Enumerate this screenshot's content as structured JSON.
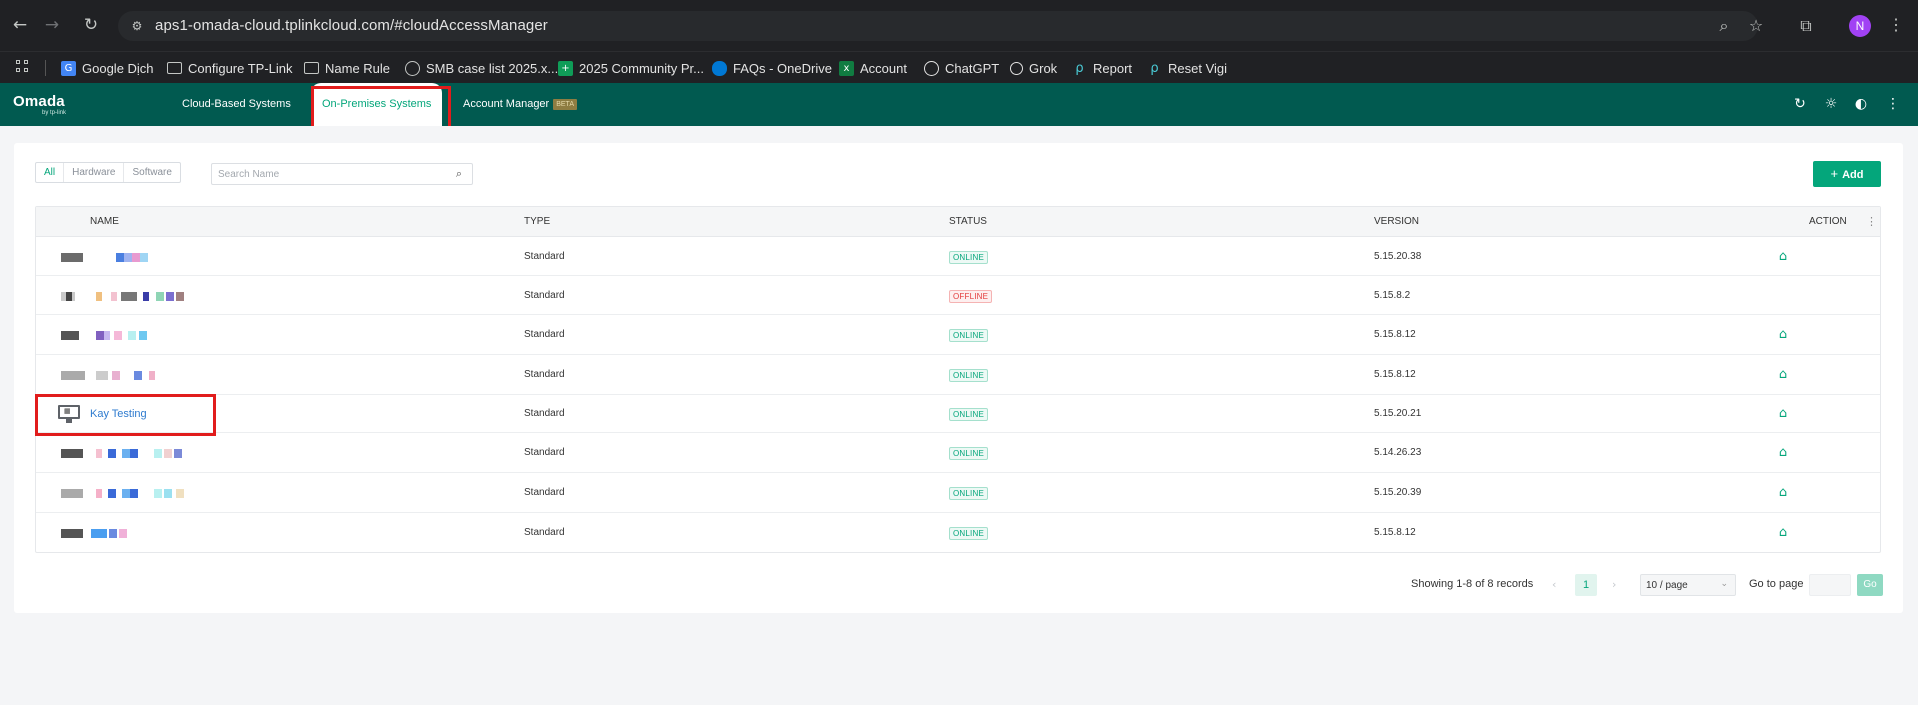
{
  "browser": {
    "url": "aps1-omada-cloud.tplinkcloud.com/#cloudAccessManager",
    "profile_initial": "N",
    "bookmarks": [
      {
        "label": "Google Dịch",
        "icon": "google-translate-icon"
      },
      {
        "label": "Configure TP-Link",
        "icon": "folder-icon"
      },
      {
        "label": "Name Rule",
        "icon": "folder-icon"
      },
      {
        "label": "SMB case list 2025.x...",
        "icon": "globe-icon"
      },
      {
        "label": "2025 Community Pr...",
        "icon": "sheets-icon"
      },
      {
        "label": "FAQs - OneDrive",
        "icon": "onedrive-icon"
      },
      {
        "label": "Account",
        "icon": "excel-icon"
      },
      {
        "label": "ChatGPT",
        "icon": "chatgpt-icon"
      },
      {
        "label": "Grok",
        "icon": "grok-icon"
      },
      {
        "label": "Report",
        "icon": "tplink-icon"
      },
      {
        "label": "Reset Vigi",
        "icon": "tplink-icon"
      }
    ]
  },
  "app": {
    "brand": "omada",
    "brand_sub": "by tp-link",
    "tabs": [
      {
        "label": "Cloud-Based Systems"
      },
      {
        "label": "On-Premises Systems"
      },
      {
        "label": "Account Manager",
        "badge": "BETA"
      }
    ],
    "accent_color": "#04a67b",
    "header_color": "#015a50"
  },
  "toolbar": {
    "filters": [
      "All",
      "Hardware",
      "Software"
    ],
    "active_filter": "All",
    "search_placeholder": "Search Name",
    "add_label": "Add"
  },
  "table": {
    "columns": [
      "NAME",
      "TYPE",
      "STATUS",
      "VERSION",
      "ACTION"
    ],
    "rows": [
      {
        "name": "",
        "type": "Standard",
        "status": "ONLINE",
        "version": "5.15.20.38",
        "has_action": true
      },
      {
        "name": "",
        "type": "Standard",
        "status": "OFFLINE",
        "version": "5.15.8.2",
        "has_action": false
      },
      {
        "name": "",
        "type": "Standard",
        "status": "ONLINE",
        "version": "5.15.8.12",
        "has_action": true
      },
      {
        "name": "",
        "type": "Standard",
        "status": "ONLINE",
        "version": "5.15.8.12",
        "has_action": true
      },
      {
        "name": "Kay Testing",
        "type": "Standard",
        "status": "ONLINE",
        "version": "5.15.20.21",
        "has_action": true
      },
      {
        "name": "",
        "type": "Standard",
        "status": "ONLINE",
        "version": "5.14.26.23",
        "has_action": true
      },
      {
        "name": "",
        "type": "Standard",
        "status": "ONLINE",
        "version": "5.15.20.39",
        "has_action": true
      },
      {
        "name": "",
        "type": "Standard",
        "status": "ONLINE",
        "version": "5.15.8.12",
        "has_action": true
      }
    ]
  },
  "pagination": {
    "summary": "Showing 1-8 of 8 records",
    "current_page": "1",
    "page_size": "10 / page",
    "goto_label": "Go to page",
    "go_label": "Go"
  }
}
